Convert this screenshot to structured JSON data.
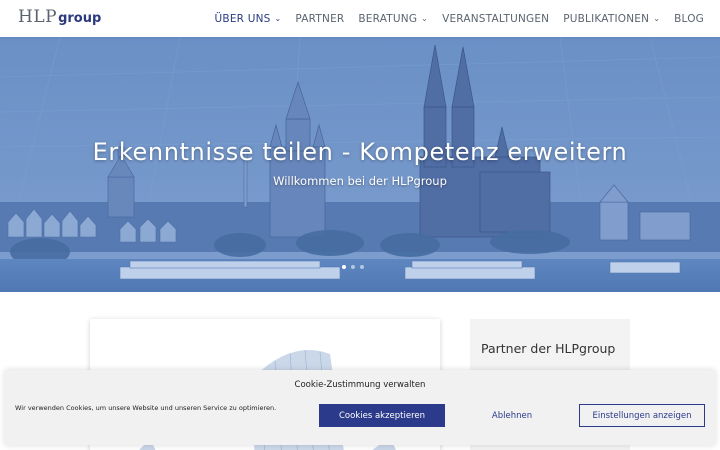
{
  "header": {
    "logo_main": "HLP",
    "logo_sub": "group",
    "nav": [
      {
        "label": "ÜBER UNS",
        "has_dropdown": true,
        "active": true
      },
      {
        "label": "PARTNER",
        "has_dropdown": false,
        "active": false
      },
      {
        "label": "BERATUNG",
        "has_dropdown": true,
        "active": false
      },
      {
        "label": "VERANSTALTUNGEN",
        "has_dropdown": false,
        "active": false
      },
      {
        "label": "PUBLIKATIONEN",
        "has_dropdown": true,
        "active": false
      },
      {
        "label": "BLOG",
        "has_dropdown": false,
        "active": false
      }
    ]
  },
  "hero": {
    "title": "Erkenntnisse teilen - Kompetenz erweitern",
    "subtitle": "Willkommen bei der HLPgroup",
    "slides": 3,
    "active_slide": 1
  },
  "sidebar": {
    "title": "Partner der HLPgroup"
  },
  "cookie": {
    "title": "Cookie-Zustimmung verwalten",
    "text": "Wir verwenden Cookies, um unsere Website und unseren Service zu optimieren.",
    "accept_label": "Cookies akzeptieren",
    "deny_label": "Ablehnen",
    "settings_label": "Einstellungen anzeigen"
  },
  "colors": {
    "brand": "#2b3a7e",
    "hero_tint": "#5b86c4",
    "cookie_bg": "#f1f1f1"
  }
}
